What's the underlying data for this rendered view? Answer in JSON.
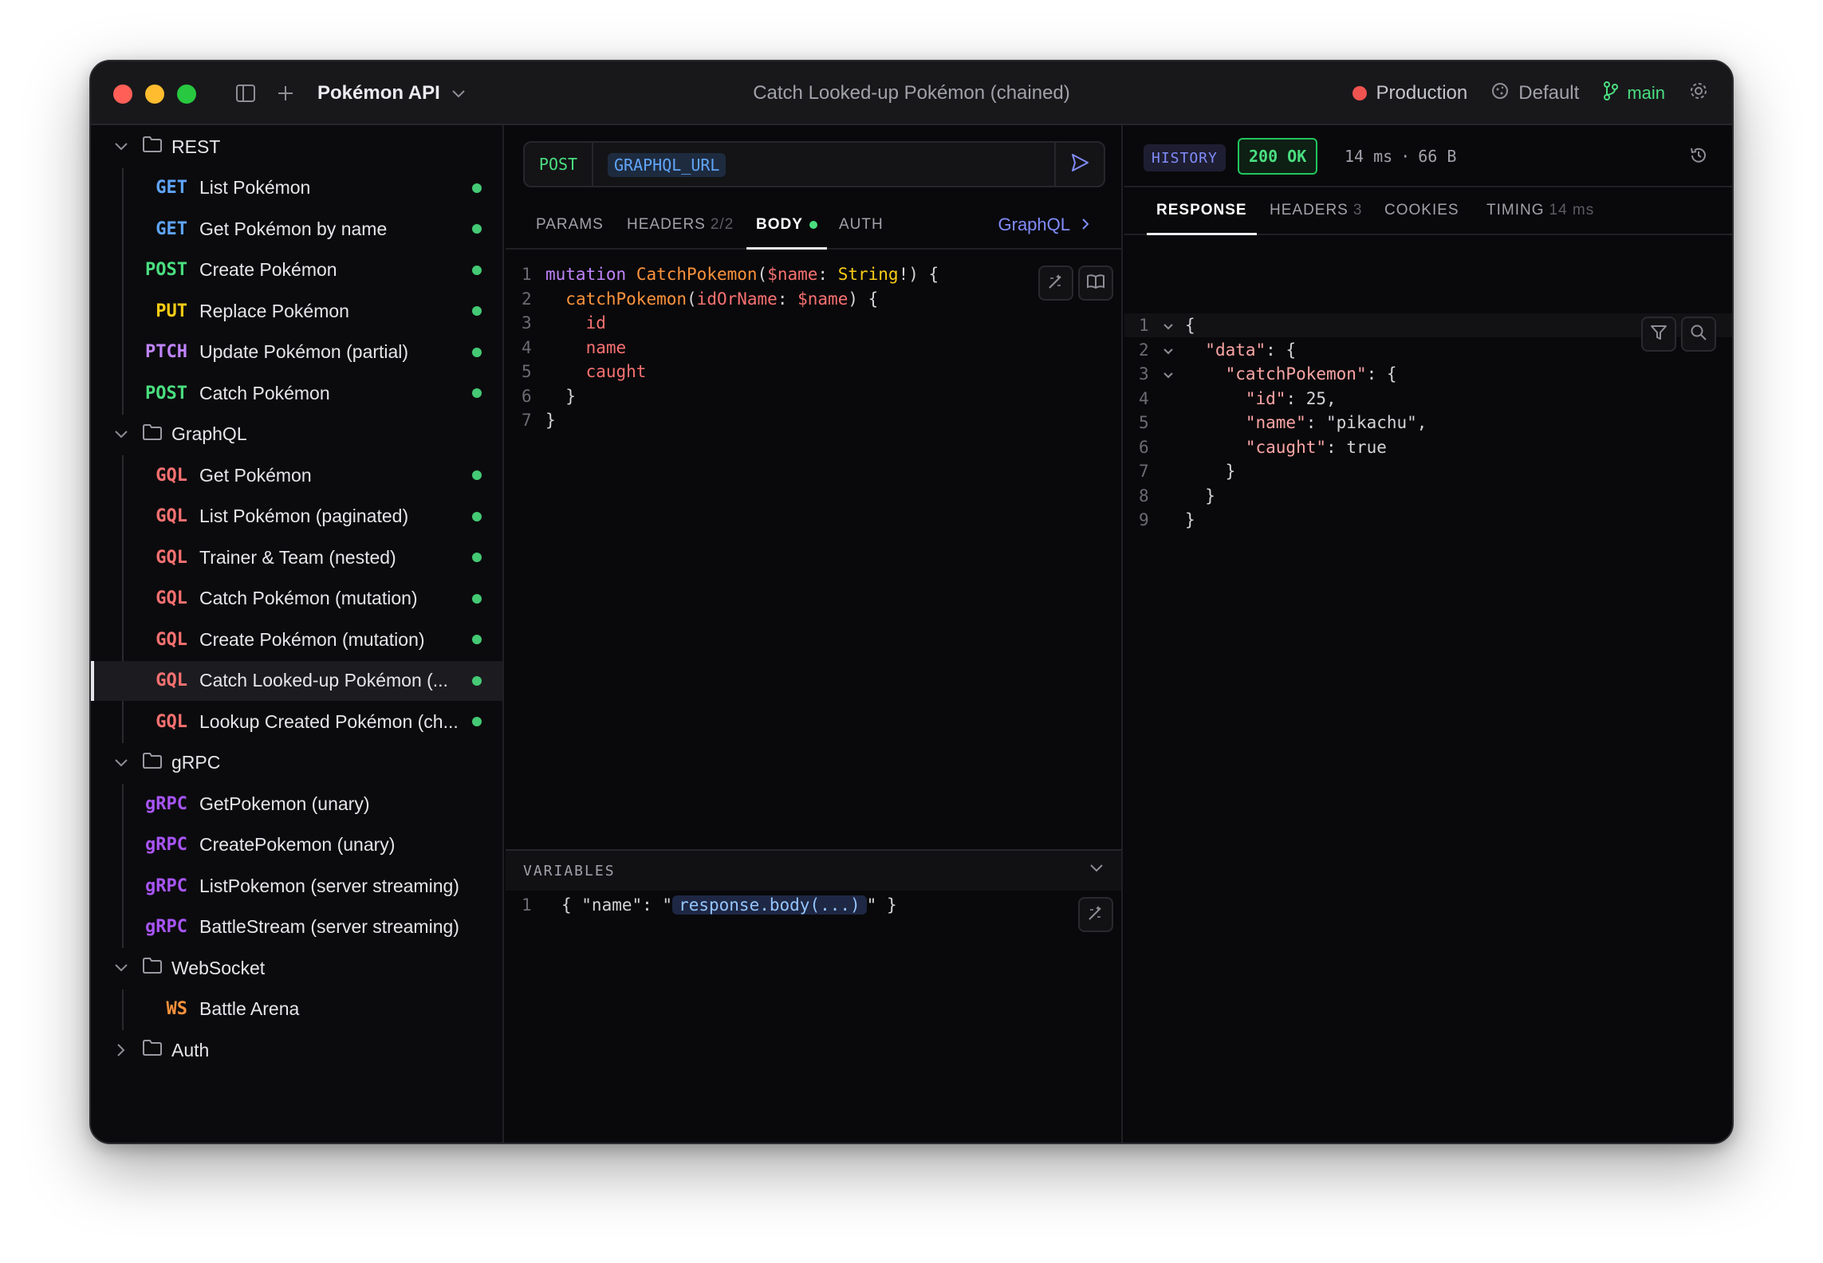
{
  "titlebar": {
    "workspace": "Pokémon API",
    "title": "Catch Looked-up Pokémon (chained)",
    "environment": "Production",
    "profile": "Default",
    "branch": "main"
  },
  "sidebar": {
    "folders": [
      {
        "name": "REST",
        "expanded": true,
        "items": [
          {
            "method": "GET",
            "label": "List Pokémon"
          },
          {
            "method": "GET",
            "label": "Get Pokémon by name"
          },
          {
            "method": "POST",
            "label": "Create Pokémon"
          },
          {
            "method": "PUT",
            "label": "Replace Pokémon"
          },
          {
            "method": "PTCH",
            "label": "Update Pokémon (partial)"
          },
          {
            "method": "POST",
            "label": "Catch Pokémon"
          }
        ]
      },
      {
        "name": "GraphQL",
        "expanded": true,
        "items": [
          {
            "method": "GQL",
            "label": "Get Pokémon"
          },
          {
            "method": "GQL",
            "label": "List Pokémon (paginated)"
          },
          {
            "method": "GQL",
            "label": "Trainer & Team (nested)"
          },
          {
            "method": "GQL",
            "label": "Catch Pokémon (mutation)"
          },
          {
            "method": "GQL",
            "label": "Create Pokémon (mutation)"
          },
          {
            "method": "GQL",
            "label": "Catch Looked-up Pokémon (..."
          },
          {
            "method": "GQL",
            "label": "Lookup Created Pokémon (ch..."
          }
        ]
      },
      {
        "name": "gRPC",
        "expanded": true,
        "items": [
          {
            "method": "gRPC",
            "label": "GetPokemon (unary)"
          },
          {
            "method": "gRPC",
            "label": "CreatePokemon (unary)"
          },
          {
            "method": "gRPC",
            "label": "ListPokemon (server streaming)"
          },
          {
            "method": "gRPC",
            "label": "BattleStream (server streaming)"
          }
        ]
      },
      {
        "name": "WebSocket",
        "expanded": true,
        "items": [
          {
            "method": "WS",
            "label": "Battle Arena"
          }
        ]
      },
      {
        "name": "Auth",
        "expanded": false,
        "items": []
      }
    ]
  },
  "request": {
    "method": "POST",
    "url_var": "GRAPHQL_URL",
    "tabs": {
      "params": "PARAMS",
      "headers": "HEADERS",
      "headers_count": "2/2",
      "body": "BODY",
      "auth": "AUTH"
    },
    "body_type": "GraphQL",
    "query_lines": [
      {
        "n": "1",
        "t": "mutation CatchPokemon($name: String!) {"
      },
      {
        "n": "2",
        "t": "  catchPokemon(idOrName: $name) {"
      },
      {
        "n": "3",
        "t": "    id"
      },
      {
        "n": "4",
        "t": "    name"
      },
      {
        "n": "5",
        "t": "    caught"
      },
      {
        "n": "6",
        "t": "  }"
      },
      {
        "n": "7",
        "t": "}"
      }
    ],
    "variables_title": "VARIABLES",
    "variables_line": {
      "n": "1",
      "prefix": "{ \"name\": \"",
      "template": "response.body(...)",
      "suffix": "\" }"
    }
  },
  "response": {
    "history": "HISTORY",
    "status": "200 OK",
    "time": "14 ms",
    "separator": "·",
    "size": "66 B",
    "tabs": {
      "response": "RESPONSE",
      "headers": "HEADERS",
      "headers_count": "3",
      "cookies": "COOKIES",
      "timing": "TIMING",
      "timing_value": "14 ms"
    },
    "lines": [
      {
        "n": "1",
        "t": "{"
      },
      {
        "n": "2",
        "t": "  \"data\": {"
      },
      {
        "n": "3",
        "t": "    \"catchPokemon\": {"
      },
      {
        "n": "4",
        "t": "      \"id\": 25,"
      },
      {
        "n": "5",
        "t": "      \"name\": \"pikachu\","
      },
      {
        "n": "6",
        "t": "      \"caught\": true"
      },
      {
        "n": "7",
        "t": "    }"
      },
      {
        "n": "8",
        "t": "  }"
      },
      {
        "n": "9",
        "t": "}"
      }
    ]
  },
  "colors": {
    "accent": "#818cf8",
    "success": "#4ade80",
    "env_production": "#ef5350"
  }
}
